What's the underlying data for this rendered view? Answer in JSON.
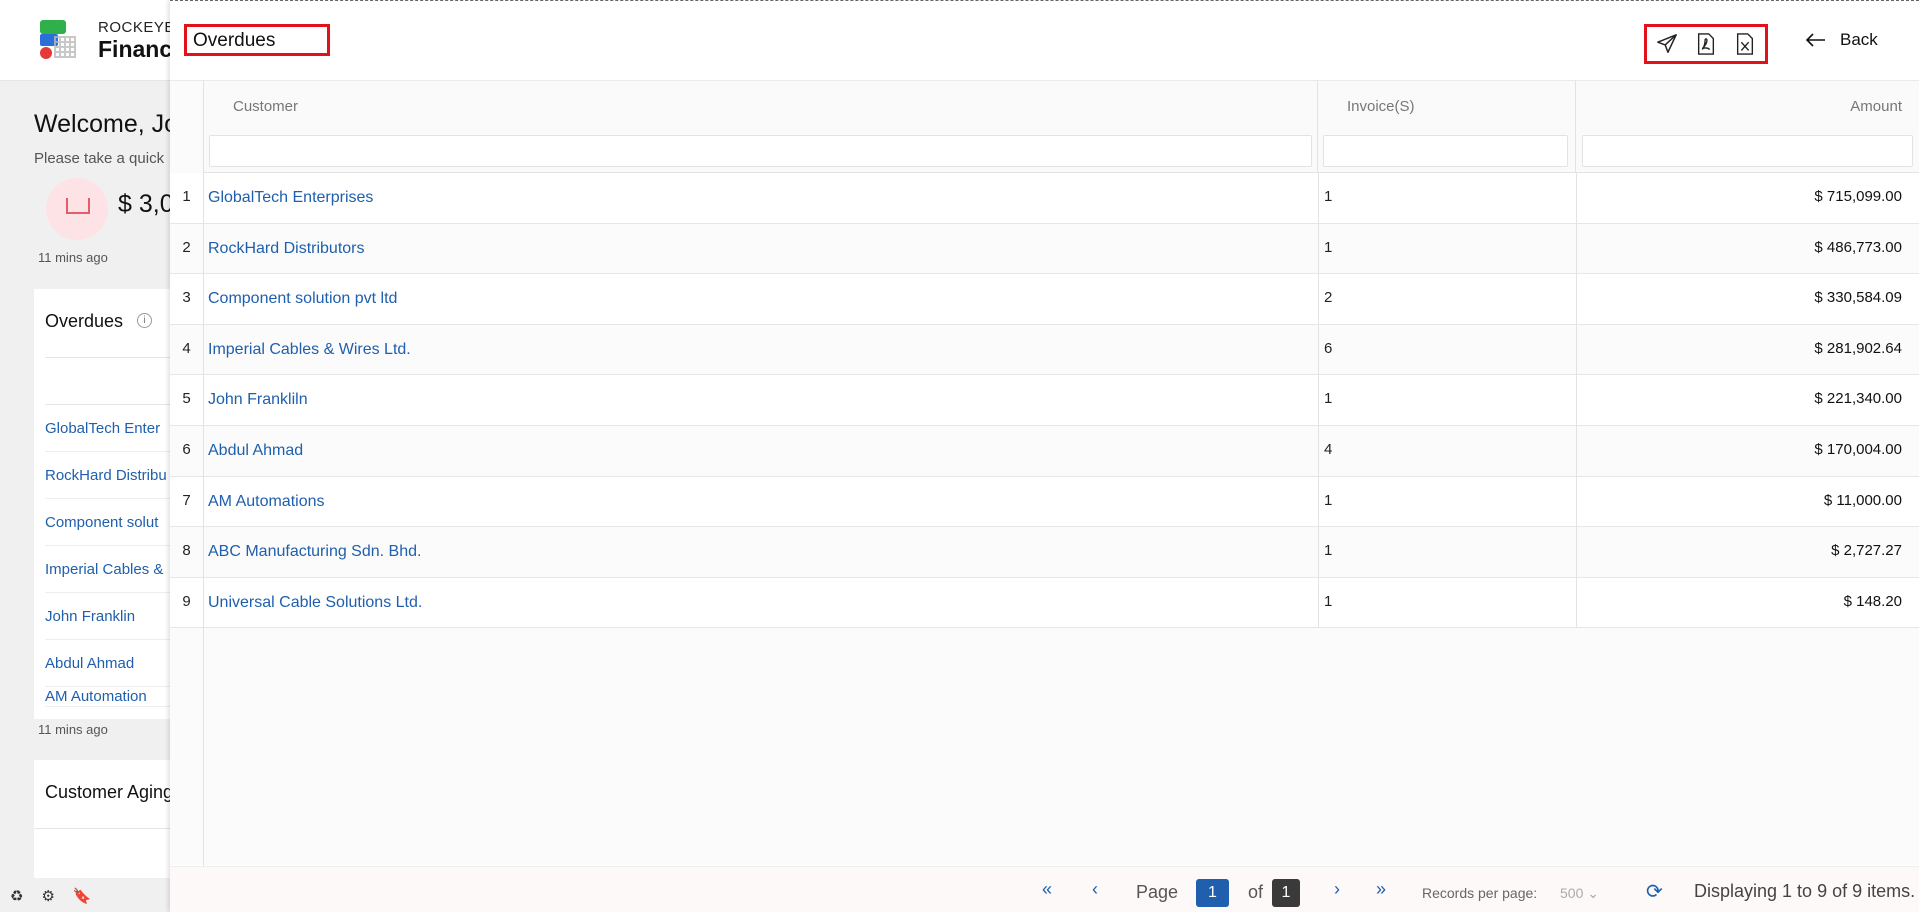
{
  "background": {
    "brand_line1": "ROCKEYE",
    "brand_line2": "Financ",
    "welcome": "Welcome, Jo",
    "subtitle": "Please take a quick",
    "amount_partial": "$ 3,0",
    "time_ago_1": "11 mins ago",
    "overdues_card_title": "Overdues",
    "overdues_list": [
      "GlobalTech Enter",
      "RockHard Distribu",
      "Component solut",
      "Imperial Cables &",
      "John Franklin",
      "Abdul Ahmad",
      "AM Automation"
    ],
    "time_ago_2": "11 mins ago",
    "aging_title": "Customer Aging"
  },
  "panel": {
    "title": "Overdues",
    "back_label": "Back",
    "actions": [
      "send-icon",
      "pdf-icon",
      "excel-icon"
    ]
  },
  "grid": {
    "columns": {
      "customer": "Customer",
      "invoices": "Invoice(S)",
      "amount": "Amount"
    },
    "rows": [
      {
        "num": "1",
        "customer": "GlobalTech Enterprises",
        "invoices": "1",
        "amount": "$ 715,099.00"
      },
      {
        "num": "2",
        "customer": "RockHard Distributors",
        "invoices": "1",
        "amount": "$ 486,773.00"
      },
      {
        "num": "3",
        "customer": "Component solution pvt ltd",
        "invoices": "2",
        "amount": "$ 330,584.09"
      },
      {
        "num": "4",
        "customer": "Imperial Cables & Wires Ltd.",
        "invoices": "6",
        "amount": "$ 281,902.64"
      },
      {
        "num": "5",
        "customer": "John Frankliln",
        "invoices": "1",
        "amount": "$ 221,340.00"
      },
      {
        "num": "6",
        "customer": "Abdul Ahmad",
        "invoices": "4",
        "amount": "$ 170,004.00"
      },
      {
        "num": "7",
        "customer": "AM Automations",
        "invoices": "1",
        "amount": "$ 11,000.00"
      },
      {
        "num": "8",
        "customer": "ABC Manufacturing Sdn. Bhd.",
        "invoices": "1",
        "amount": "$ 2,727.27"
      },
      {
        "num": "9",
        "customer": "Universal Cable Solutions Ltd.",
        "invoices": "1",
        "amount": "$ 148.20"
      }
    ]
  },
  "pager": {
    "page_label": "Page",
    "current_page": "1",
    "of_label": "of",
    "total_pages": "1",
    "records_label": "Records per page:",
    "records_value": "500",
    "display_text": "Displaying 1 to 9 of 9 items."
  },
  "colors": {
    "accent": "#1f5fad",
    "highlight": "#e3121a",
    "page_active": "#1f5fad",
    "page_total": "#3a3a3a"
  }
}
